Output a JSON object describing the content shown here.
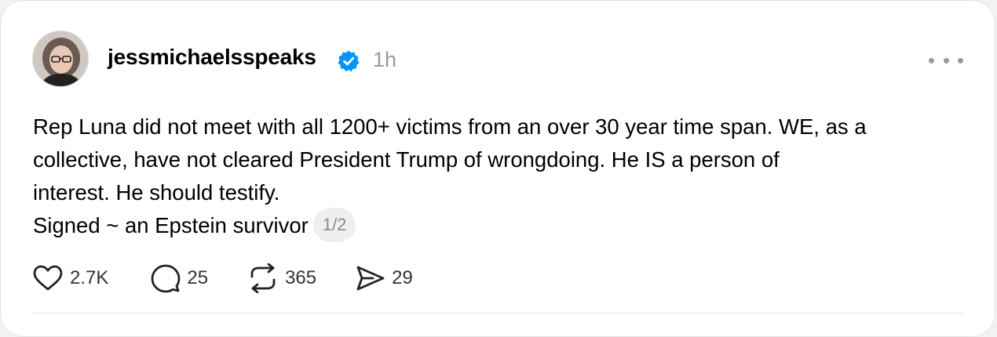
{
  "post": {
    "author": {
      "username": "jessmichaelsspeaks",
      "verified": true,
      "avatar_alt": "profile photo"
    },
    "timestamp": "1h",
    "text_lines": [
      "Rep Luna did not meet with all 1200+ victims from an over 30 year time span. WE, as a",
      "collective, have not cleared President Trump of wrongdoing. He IS a person of",
      "interest. He should testify.",
      "Signed ~ an Epstein survivor"
    ],
    "thread_indicator": "1/2",
    "actions": {
      "likes": "2.7K",
      "replies": "25",
      "reposts": "365",
      "shares": "29"
    },
    "icons": {
      "like": "heart-icon",
      "reply": "speech-bubble-icon",
      "repost": "repost-arrows-icon",
      "share": "send-icon",
      "verified": "verified-badge-icon",
      "more": "more-options-icon"
    },
    "colors": {
      "verified_badge": "#0095f6",
      "muted_text": "#9a9a9a"
    }
  }
}
